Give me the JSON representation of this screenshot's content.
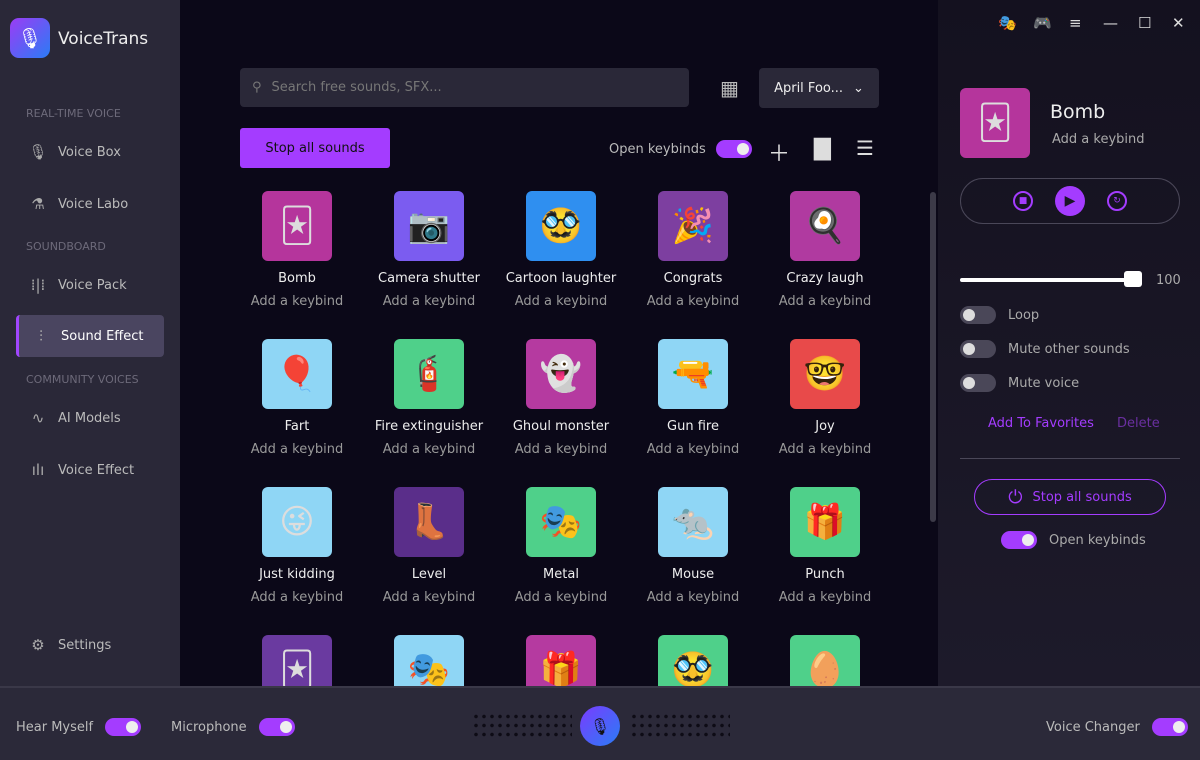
{
  "app": {
    "name": "VoiceTrans"
  },
  "sidebar": {
    "sections": [
      "REAL-TIME VOICE",
      "SOUNDBOARD",
      "COMMUNITY VOICES"
    ],
    "items": [
      {
        "label": "Voice Box",
        "icon": "microphone-icon"
      },
      {
        "label": "Voice Labo",
        "icon": "flask-icon"
      },
      {
        "label": "Voice Pack",
        "icon": "waveform-icon"
      },
      {
        "label": "Sound Effect",
        "icon": "equalizer-icon",
        "active": true
      },
      {
        "label": "AI Models",
        "icon": "wave-icon"
      },
      {
        "label": "Voice Effect",
        "icon": "waveform-icon"
      }
    ],
    "settings": "Settings"
  },
  "toolbar": {
    "search_placeholder": "Search free sounds, SFX...",
    "category": "April Foo...",
    "stop_all": "Stop all sounds",
    "open_keybinds": "Open keybinds"
  },
  "sounds": [
    {
      "name": "Bomb",
      "keybind": "Add a keybind",
      "color": "#b5359c",
      "glyph": "🃏"
    },
    {
      "name": "Camera shutter",
      "keybind": "Add a keybind",
      "color": "#7b5cf0",
      "glyph": "📷"
    },
    {
      "name": "Cartoon laughter",
      "keybind": "Add a keybind",
      "color": "#2f8ff0",
      "glyph": "🥸"
    },
    {
      "name": "Congrats",
      "keybind": "Add a keybind",
      "color": "#7d3fa0",
      "glyph": "🎉"
    },
    {
      "name": "Crazy laugh",
      "keybind": "Add a keybind",
      "color": "#b03aa0",
      "glyph": "🍳"
    },
    {
      "name": "Fart",
      "keybind": "Add a keybind",
      "color": "#8fd6f5",
      "glyph": "🎈"
    },
    {
      "name": "Fire extinguisher",
      "keybind": "Add a keybind",
      "color": "#4fd08a",
      "glyph": "🧯"
    },
    {
      "name": "Ghoul monster",
      "keybind": "Add a keybind",
      "color": "#b53aa0",
      "glyph": "👻"
    },
    {
      "name": "Gun fire",
      "keybind": "Add a keybind",
      "color": "#8fd6f5",
      "glyph": "🔫"
    },
    {
      "name": "Joy",
      "keybind": "Add a keybind",
      "color": "#e84a4a",
      "glyph": "🤓"
    },
    {
      "name": "Just kidding",
      "keybind": "Add a keybind",
      "color": "#8fd6f5",
      "glyph": "😜"
    },
    {
      "name": "Level",
      "keybind": "Add a keybind",
      "color": "#5a2e8a",
      "glyph": "👢"
    },
    {
      "name": "Metal",
      "keybind": "Add a keybind",
      "color": "#4fd08a",
      "glyph": "🎭"
    },
    {
      "name": "Mouse",
      "keybind": "Add a keybind",
      "color": "#8fd6f5",
      "glyph": "🐀"
    },
    {
      "name": "Punch",
      "keybind": "Add a keybind",
      "color": "#4fd08a",
      "glyph": "🎁"
    },
    {
      "name": "",
      "keybind": "",
      "color": "#6a3aa0",
      "glyph": "🃏"
    },
    {
      "name": "",
      "keybind": "",
      "color": "#8fd6f5",
      "glyph": "🎭"
    },
    {
      "name": "",
      "keybind": "",
      "color": "#b53aa0",
      "glyph": "🎁"
    },
    {
      "name": "",
      "keybind": "",
      "color": "#4fd08a",
      "glyph": "🥸"
    },
    {
      "name": "",
      "keybind": "",
      "color": "#4fd08a",
      "glyph": "🥚"
    }
  ],
  "detail": {
    "name": "Bomb",
    "keybind": "Add a keybind",
    "volume": 100,
    "options": [
      {
        "label": "Loop",
        "on": false
      },
      {
        "label": "Mute other sounds",
        "on": false
      },
      {
        "label": "Mute voice",
        "on": false
      }
    ],
    "favorites": "Add To Favorites",
    "delete": "Delete",
    "stop_all": "Stop all sounds",
    "open_keybinds": "Open keybinds"
  },
  "bottom": {
    "hear_myself": "Hear Myself",
    "microphone": "Microphone",
    "voice_changer": "Voice Changer"
  },
  "colors": {
    "accent": "#a43cff",
    "sidebar": "#2a2838",
    "background": "#0b0818"
  }
}
